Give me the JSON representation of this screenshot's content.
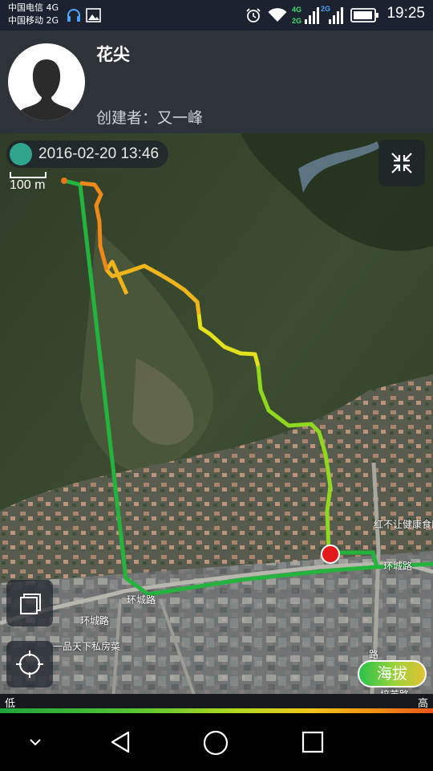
{
  "status_bar": {
    "carrier_1": "中国电信 4G",
    "carrier_2": "中国移动 2G",
    "time": "19:25",
    "icons": [
      "headset-icon",
      "image-icon",
      "alarm-icon",
      "wifi-icon",
      "signal-4g-icon",
      "signal-2g-icon",
      "battery-icon"
    ],
    "network_1": "4G",
    "network_2": "2G",
    "network_3": "2G"
  },
  "header": {
    "route_name": "花尖",
    "creator": "创建者：又一峰"
  },
  "map": {
    "date": "2016-02-20 13:46",
    "scale": "100 m",
    "place_labels": {
      "ring_road_1": "环城路",
      "ring_road_2": "环城路",
      "ring_road_3": "环城路",
      "restaurant": "一品天下私房菜",
      "canteen": "红不让健康食府",
      "road_a": "路",
      "road_b": "培英路"
    },
    "altitude_button": "海拔",
    "legend_low": "低",
    "legend_high": "高",
    "colors": {
      "track_low": "#1fae3a",
      "track_mid": "#b9e21c",
      "track_high": "#f0871a",
      "current_point": "#e21a1a"
    }
  },
  "nav_bar": {
    "buttons": [
      "back",
      "home",
      "recents"
    ]
  }
}
